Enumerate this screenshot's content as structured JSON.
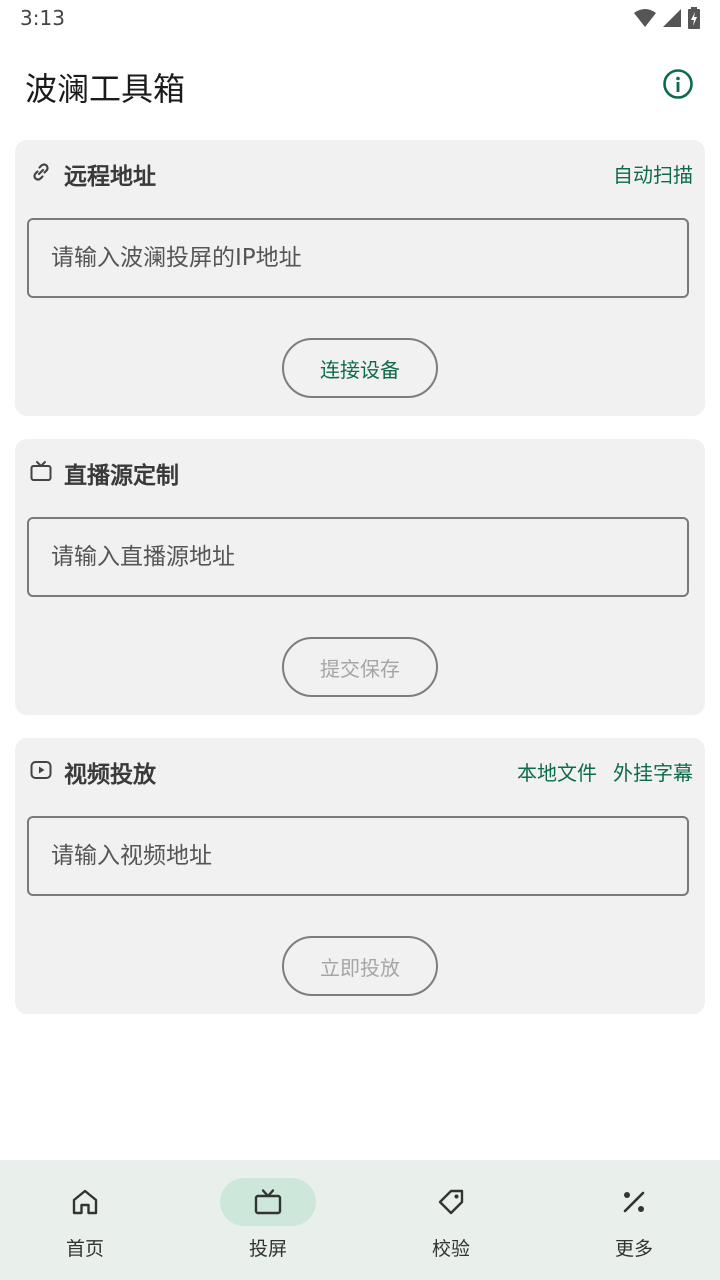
{
  "status_bar": {
    "time": "3:13"
  },
  "app_bar": {
    "title": "波澜工具箱",
    "info_icon": "info-circle-icon"
  },
  "cards": [
    {
      "icon": "link-icon",
      "title": "远程地址",
      "actions": [
        "自动扫描"
      ],
      "input_placeholder": "请输入波澜投屏的IP地址",
      "input_value": "",
      "button_label": "连接设备",
      "button_enabled": true
    },
    {
      "icon": "tv-icon",
      "title": "直播源定制",
      "actions": [],
      "input_placeholder": "请输入直播源地址",
      "input_value": "",
      "button_label": "提交保存",
      "button_enabled": false
    },
    {
      "icon": "play-icon",
      "title": "视频投放",
      "actions": [
        "本地文件",
        "外挂字幕"
      ],
      "input_placeholder": "请输入视频地址",
      "input_value": "",
      "button_label": "立即投放",
      "button_enabled": false
    }
  ],
  "bottom_nav": {
    "selected_index": 1,
    "items": [
      {
        "label": "首页",
        "icon": "home-icon"
      },
      {
        "label": "投屏",
        "icon": "tv-icon"
      },
      {
        "label": "校验",
        "icon": "tag-icon"
      },
      {
        "label": "更多",
        "icon": "percent-icon"
      }
    ]
  },
  "colors": {
    "accent": "#0e6a4a",
    "card_bg": "#f1f1f1",
    "nav_bg": "#e9f0ec",
    "nav_selected": "#cde8da"
  }
}
